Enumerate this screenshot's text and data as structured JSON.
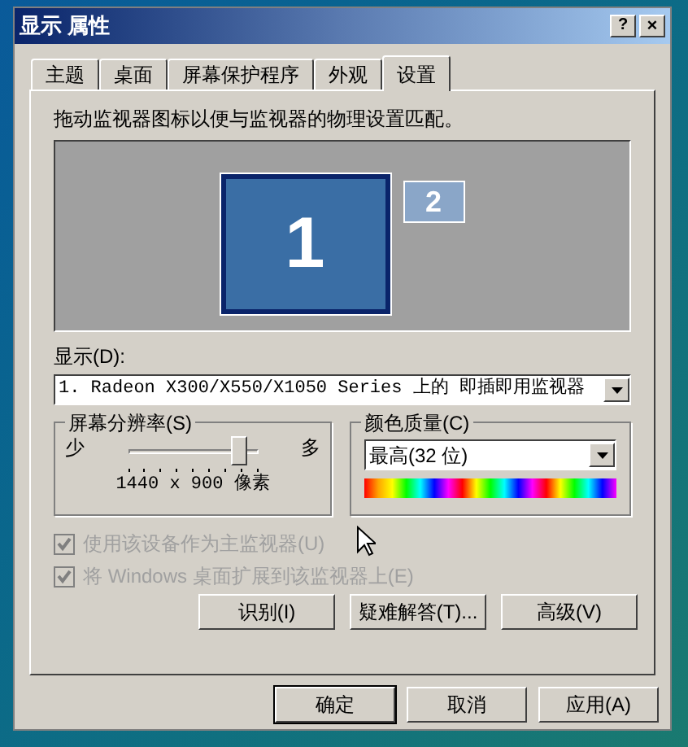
{
  "window": {
    "title": "显示 属性",
    "help_button": "?",
    "close_button": "×"
  },
  "tabs": [
    {
      "label": "主题",
      "selected": false
    },
    {
      "label": "桌面",
      "selected": false
    },
    {
      "label": "屏幕保护程序",
      "selected": false
    },
    {
      "label": "外观",
      "selected": false
    },
    {
      "label": "设置",
      "selected": true
    }
  ],
  "instruction": "拖动监视器图标以便与监视器的物理设置匹配。",
  "monitors": [
    {
      "label": "1",
      "selected": true
    },
    {
      "label": "2",
      "selected": false
    }
  ],
  "display": {
    "label": "显示(D):",
    "value": "1. Radeon X300/X550/X1050 Series 上的 即插即用监视器"
  },
  "resolution": {
    "title": "屏幕分辨率(S)",
    "min_label": "少",
    "max_label": "多",
    "level": 0.9,
    "reading": "1440 x 900 像素"
  },
  "color_quality": {
    "title": "颜色质量(C)",
    "value": "最高(32 位)"
  },
  "checkboxes": [
    {
      "label": "使用该设备作为主监视器(U)",
      "checked": true,
      "disabled": true
    },
    {
      "label": "将 Windows 桌面扩展到该监视器上(E)",
      "checked": true,
      "disabled": true
    }
  ],
  "actions": [
    "识别(I)",
    "疑难解答(T)...",
    "高级(V)"
  ],
  "buttons": [
    {
      "label": "确定",
      "default": true
    },
    {
      "label": "取消",
      "default": false
    },
    {
      "label": "应用(A)",
      "default": false
    }
  ]
}
